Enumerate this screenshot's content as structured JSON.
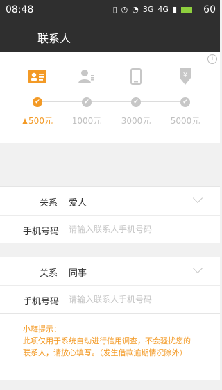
{
  "status_bar": {
    "time": "08:48",
    "battery_level": "60",
    "network": "3G",
    "signal_label": "4G"
  },
  "header": {
    "title": "联系人"
  },
  "progress": {
    "steps": [
      {
        "amount": "500元",
        "active": true,
        "icon": "id-card-icon"
      },
      {
        "amount": "1000元",
        "active": false,
        "icon": "contact-person-icon"
      },
      {
        "amount": "3000元",
        "active": false,
        "icon": "phone-icon"
      },
      {
        "amount": "5000元",
        "active": false,
        "icon": "yen-coin-icon"
      }
    ]
  },
  "contact1": {
    "relation_label": "关系",
    "relation_value": "爱人",
    "phone_label": "手机号码",
    "phone_placeholder": "请输入联系人手机号码",
    "phone_value": ""
  },
  "contact2": {
    "relation_label": "关系",
    "relation_value": "同事",
    "phone_label": "手机号码",
    "phone_placeholder": "请输入联系人手机号码",
    "phone_value": ""
  },
  "tips": {
    "title": "小嗨提示：",
    "text": "此项仅用于系统自动进行信用调查，不会骚扰您的联系人，请放心填写。（发生借款逾期情况除外）"
  },
  "colors": {
    "accent": "#f39a26",
    "header_bg": "#2f2f2f",
    "inactive": "#c7c7c7"
  }
}
